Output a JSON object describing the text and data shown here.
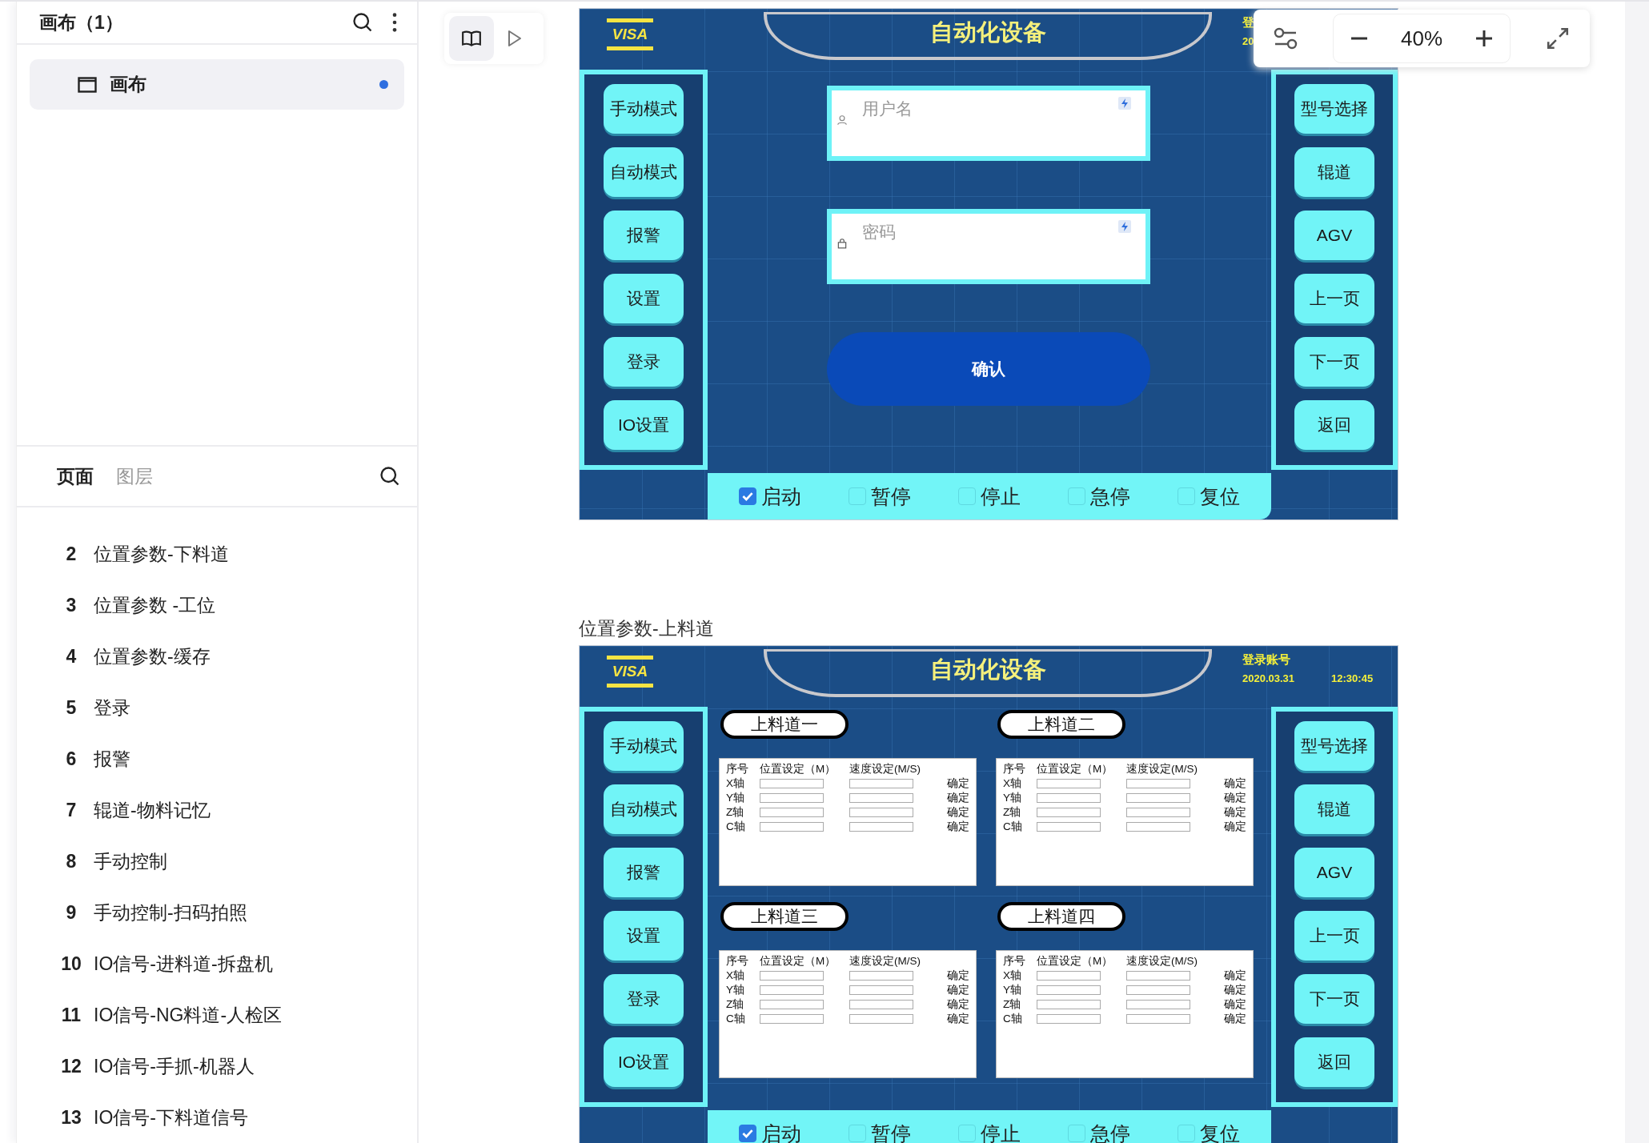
{
  "layers_panel": {
    "title": "画布（1）",
    "canvas_item": {
      "label": "画布",
      "selected": true
    },
    "tabs": [
      {
        "label": "页面",
        "selected": true
      },
      {
        "label": "图层",
        "selected": false
      }
    ],
    "pages": [
      {
        "number": "2",
        "name": "位置参数-下料道"
      },
      {
        "number": "3",
        "name": "位置参数 -工位"
      },
      {
        "number": "4",
        "name": "位置参数-缓存"
      },
      {
        "number": "5",
        "name": "登录"
      },
      {
        "number": "6",
        "name": "报警"
      },
      {
        "number": "7",
        "name": "辊道-物料记忆"
      },
      {
        "number": "8",
        "name": "手动控制"
      },
      {
        "number": "9",
        "name": "手动控制-扫码拍照"
      },
      {
        "number": "10",
        "name": "IO信号-进料道-拆盘机"
      },
      {
        "number": "11",
        "name": "IO信号-NG料道-人检区"
      },
      {
        "number": "12",
        "name": "IO信号-手抓-机器人"
      },
      {
        "number": "13",
        "name": "IO信号-下料道信号"
      }
    ]
  },
  "zoom": {
    "value": "40%"
  },
  "frames": [
    {
      "kind": "login",
      "logo": "VISA",
      "title": "自动化设备",
      "header_info": {
        "account": "登",
        "date": "20"
      },
      "left_buttons": [
        "手动模式",
        "自动模式",
        "报警",
        "设置",
        "登录",
        "IO设置"
      ],
      "right_buttons": [
        "型号选择",
        "辊道",
        "AGV",
        "上一页",
        "下一页",
        "返回"
      ],
      "bottom_controls": [
        {
          "label": "启动",
          "checked": true
        },
        {
          "label": "暂停",
          "checked": false
        },
        {
          "label": "停止",
          "checked": false
        },
        {
          "label": "急停",
          "checked": false
        },
        {
          "label": "复位",
          "checked": false
        }
      ],
      "login": {
        "username_placeholder": "用户名",
        "password_placeholder": "密码",
        "confirm": "确认"
      }
    },
    {
      "kind": "lanes",
      "label": "位置参数-上料道",
      "logo": "VISA",
      "title": "自动化设备",
      "header_info": {
        "account": "登录账号",
        "date": "2020.03.31",
        "time": "12:30:45"
      },
      "left_buttons": [
        "手动模式",
        "自动模式",
        "报警",
        "设置",
        "登录",
        "IO设置"
      ],
      "right_buttons": [
        "型号选择",
        "辊道",
        "AGV",
        "上一页",
        "下一页",
        "返回"
      ],
      "bottom_controls": [
        {
          "label": "启动",
          "checked": true
        },
        {
          "label": "暂停",
          "checked": false
        },
        {
          "label": "停止",
          "checked": false
        },
        {
          "label": "急停",
          "checked": false
        },
        {
          "label": "复位",
          "checked": false
        }
      ],
      "lanes": [
        {
          "title": "上料道一",
          "columns": [
            "序号",
            "位置设定（M）",
            "速度设定(M/S)"
          ],
          "rows": [
            {
              "axis": "X轴",
              "action": "确定"
            },
            {
              "axis": "Y轴",
              "action": "确定"
            },
            {
              "axis": "Z轴",
              "action": "确定"
            },
            {
              "axis": "C轴",
              "action": "确定"
            }
          ]
        },
        {
          "title": "上料道二",
          "columns": [
            "序号",
            "位置设定（M）",
            "速度设定(M/S)"
          ],
          "rows": [
            {
              "axis": "X轴",
              "action": "确定"
            },
            {
              "axis": "Y轴",
              "action": "确定"
            },
            {
              "axis": "Z轴",
              "action": "确定"
            },
            {
              "axis": "C轴",
              "action": "确定"
            }
          ]
        },
        {
          "title": "上料道三",
          "columns": [
            "序号",
            "位置设定（M）",
            "速度设定(M/S)"
          ],
          "rows": [
            {
              "axis": "X轴",
              "action": "确定"
            },
            {
              "axis": "Y轴",
              "action": "确定"
            },
            {
              "axis": "Z轴",
              "action": "确定"
            },
            {
              "axis": "C轴",
              "action": "确定"
            }
          ]
        },
        {
          "title": "上料道四",
          "columns": [
            "序号",
            "位置设定（M）",
            "速度设定(M/S)"
          ],
          "rows": [
            {
              "axis": "X轴",
              "action": "确定"
            },
            {
              "axis": "Y轴",
              "action": "确定"
            },
            {
              "axis": "Z轴",
              "action": "确定"
            },
            {
              "axis": "C轴",
              "action": "确定"
            }
          ]
        }
      ]
    }
  ]
}
